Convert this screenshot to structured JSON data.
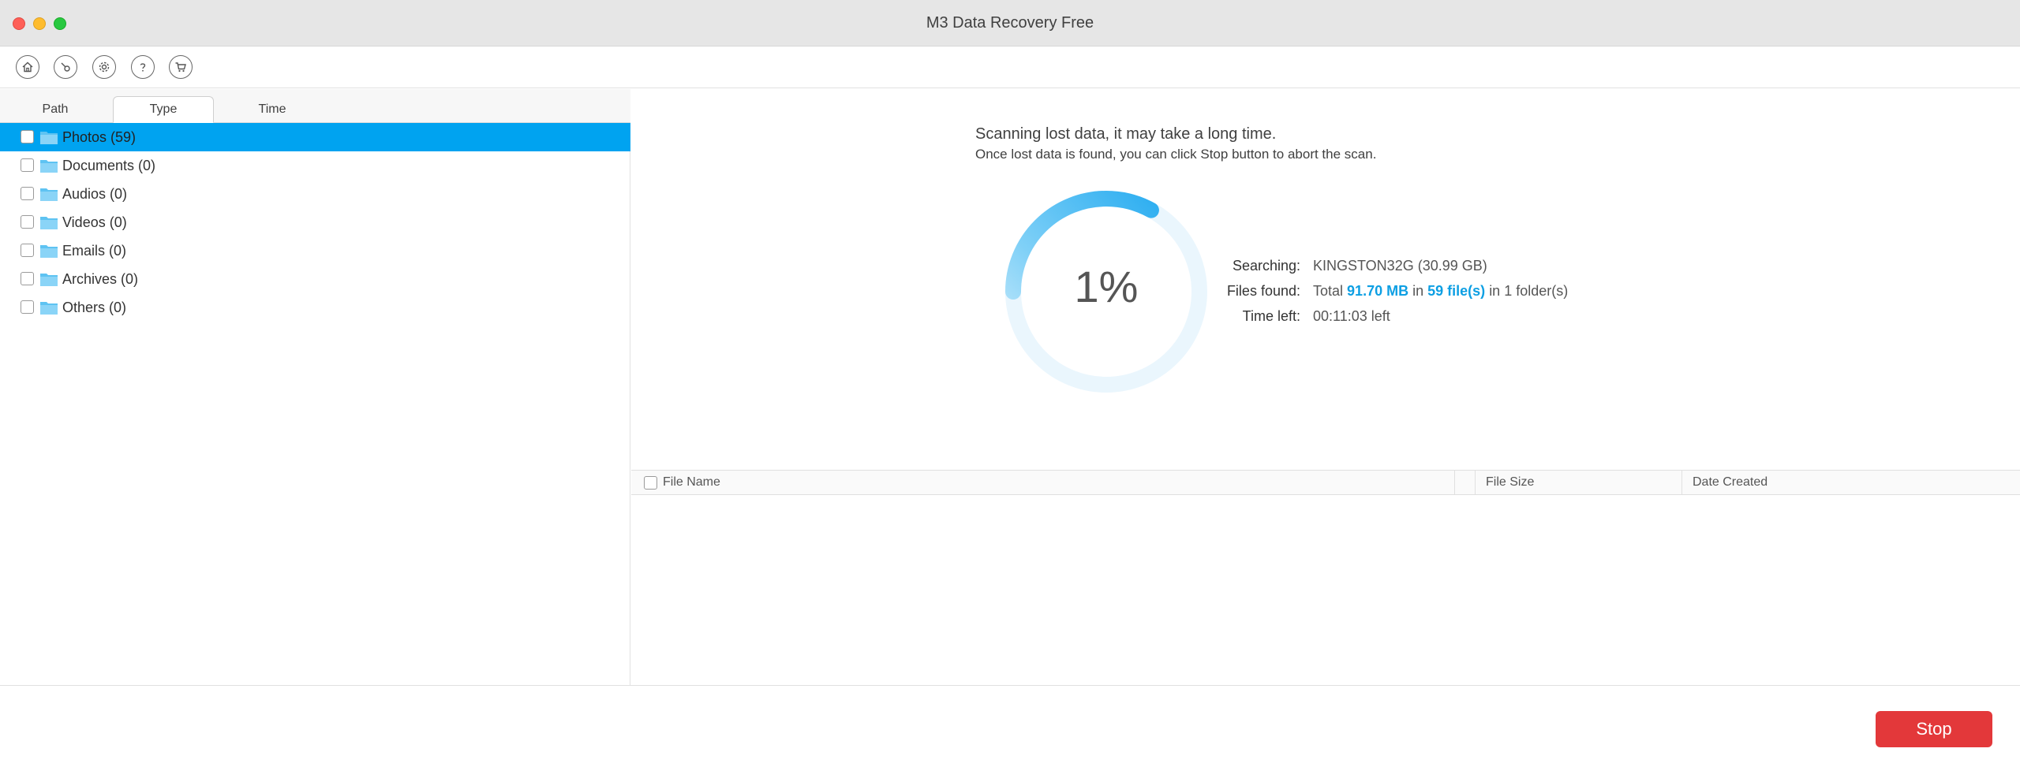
{
  "window": {
    "title": "M3 Data Recovery Free"
  },
  "toolbar": {
    "buttons": [
      {
        "icon": "home-icon"
      },
      {
        "icon": "scan-icon"
      },
      {
        "icon": "settings-icon"
      },
      {
        "icon": "help-icon"
      },
      {
        "icon": "cart-icon"
      }
    ]
  },
  "tabs": {
    "path": "Path",
    "type": "Type",
    "time": "Time",
    "active": "Type"
  },
  "tree": {
    "items": [
      {
        "label": "Photos (59)",
        "selected": true
      },
      {
        "label": "Documents (0)",
        "selected": false
      },
      {
        "label": "Audios (0)",
        "selected": false
      },
      {
        "label": "Videos (0)",
        "selected": false
      },
      {
        "label": "Emails (0)",
        "selected": false
      },
      {
        "label": "Archives (0)",
        "selected": false
      },
      {
        "label": "Others (0)",
        "selected": false
      }
    ]
  },
  "scan": {
    "message": "Scanning lost data, it may take a long time.",
    "hint": "Once lost data is found, you can click Stop button to abort the scan.",
    "percent_text": "1%",
    "progress": 0.33,
    "searching_label": "Searching:",
    "searching_value": "KINGSTON32G (30.99 GB)",
    "files_label": "Files found:",
    "files_total_prefix": "Total",
    "files_size": "91.70 MB",
    "files_in": "in",
    "files_count": "59 file(s)",
    "files_suffix": "in 1 folder(s)",
    "time_label": "Time left:",
    "time_value": "00:11:03 left"
  },
  "table": {
    "col_name": "File Name",
    "col_size": "File Size",
    "col_date": "Date Created"
  },
  "footer": {
    "stop_label": "Stop"
  },
  "colors": {
    "accent": "#00a3f0",
    "stop": "#e3383a",
    "highlight": "#0d9fe3"
  }
}
